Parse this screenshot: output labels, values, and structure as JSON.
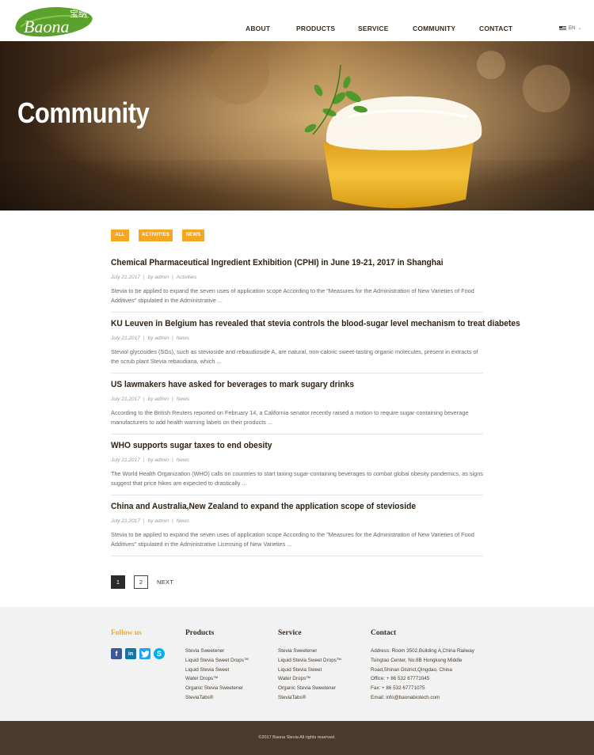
{
  "brand": {
    "name": "Baona",
    "chinese_name": "宝纳",
    "accent": "#f5a623",
    "dark": "#4a3a2b",
    "green": "#5ba12d"
  },
  "nav": {
    "items": [
      "ABOUT",
      "PRODUCTS",
      "SERVICE",
      "COMMUNITY",
      "CONTACT"
    ],
    "language": "EN"
  },
  "hero": {
    "title": "Community"
  },
  "filters": [
    "ALL",
    "ACTIVITIES",
    "NEWS"
  ],
  "articles": [
    {
      "title": "Chemical Pharmaceutical Ingredient Exhibition (CPHI) in June 19-21, 2017 in Shanghai",
      "date": "July 21,2017",
      "author": "by admin",
      "category": "Activities",
      "excerpt": "Stevia to be applied to expand the seven uses of application scope According to the \"Measures for the Administration of New Varieties of Food Additives\" stipulated in the Administrative ..."
    },
    {
      "title": "KU Leuven in Belgium has revealed that stevia controls the blood-sugar level mechanism to treat diabetes",
      "date": "July 21,2017",
      "author": "by admin",
      "category": "News",
      "excerpt": "Steviol glycosides (SGs), such as stevioside and rebaudioside A, are natural, non-caloric sweet-tasting organic molecules, present in extracts of the scrub plant Stevia rebaudiana, which ..."
    },
    {
      "title": "US lawmakers have asked for beverages to mark sugary drinks",
      "date": "July 21,2017",
      "author": "by admin",
      "category": "News",
      "excerpt": "According to the British Reuters reported on February 14, a California senator recently raised a motion to require sugar-containing beverage manufacturers to add health warning labels on their products ..."
    },
    {
      "title": "WHO supports sugar taxes to end obesity",
      "date": "July 21,2017",
      "author": "by admin",
      "category": "News",
      "excerpt": "The World Health Organization (WHO) calls on countries to start taxing sugar-containing beverages to combat global obesity pandemics, as signs suggest that price hikes are expected to drastically ..."
    },
    {
      "title": "China and Australia,New Zealand to expand the application scope of stevioside",
      "date": "July 21,2017",
      "author": "by admin",
      "category": "News",
      "excerpt": "Stevia to be applied to expand the seven uses of application scope According to the \"Measures for the Administration of New Varieties of Food Additives\" stipulated in the Administrative Licensing of New Varieties ..."
    }
  ],
  "pagination": {
    "pages": [
      "1",
      "2"
    ],
    "current": "1",
    "next": "NEXT"
  },
  "footer": {
    "follow": {
      "heading": "Follow us",
      "icons": [
        "facebook-icon",
        "linkedin-icon",
        "twitter-icon",
        "skype-icon"
      ]
    },
    "products": {
      "heading": "Products",
      "links": [
        "Stevia Sweetener",
        "Liquid Stevia Sweet Drops™",
        "Liquid Stevia Sweet",
        "Water Drops™",
        "Organic Stevia Sweetener",
        "SteviaTabs®"
      ]
    },
    "service": {
      "heading": "Service",
      "links": [
        "Stevia Sweetener",
        "Liquid Stevia Sweet Drops™",
        "Liquid Stevia Sweet",
        "Water Drops™",
        "Organic Stevia Sweetener",
        "SteviaTabs®"
      ]
    },
    "contact": {
      "heading": "Contact",
      "lines": [
        "Address: Room 3502,Building A,China Railway",
        "Tsingtao Center, No.8B Hongkong Middle",
        "Road,Shinan District,Qingdao, China",
        "Office: + 86 532 67771045",
        "Fax: + 86 532 67771075",
        "Email: info@baonabiotech.com"
      ]
    },
    "copyright": "©2017 Baona Stevia All rights reserved."
  }
}
